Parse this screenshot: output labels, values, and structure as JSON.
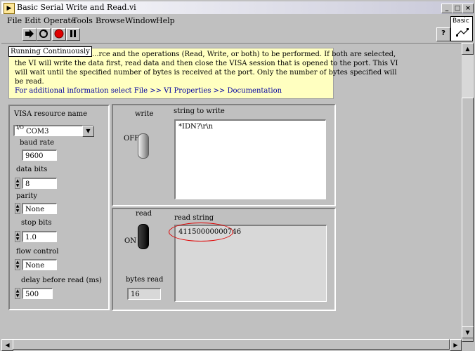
{
  "window": {
    "title": "Basic Serial Write and Read.vi",
    "controls": {
      "minimize": "_",
      "maximize": "□",
      "close": "×"
    }
  },
  "menu": [
    "File",
    "Edit",
    "Operate",
    "Tools",
    "Browse",
    "Window",
    "Help"
  ],
  "toolbar": {
    "buttons": [
      "run-arrow-icon",
      "run-continuously-icon",
      "abort-icon",
      "pause-icon"
    ],
    "help": "?",
    "palette_label": "Basic"
  },
  "status_tip": "Running Continuously",
  "description": {
    "line1": "...rce and the operations (Read, Write, or both) to be performed.  If both are selected,",
    "line2": "the VI will write the data first, read data and then close the VISA session that is opened to the port.  This VI",
    "line3": "will wait until the specified number of bytes is received at the port. Only the number of bytes specified will",
    "line4": "be read.",
    "link": "For additional information select File >> VI Properties >> Documentation"
  },
  "settings": {
    "visa_label": "VISA resource name",
    "visa_prefix": "I/O",
    "visa_value": "COM3",
    "baud_label": "baud rate",
    "baud_value": "9600",
    "databits_label": "data bits",
    "databits_value": "8",
    "parity_label": "parity",
    "parity_value": "None",
    "stopbits_label": "stop bits",
    "stopbits_value": "1.0",
    "flow_label": "flow control",
    "flow_value": "None",
    "delay_label": "delay before read (ms)",
    "delay_value": "500"
  },
  "write_section": {
    "switch_label": "write",
    "switch_state": "OFF",
    "string_label": "string to write",
    "string_value": "*IDN?\\r\\n"
  },
  "read_section": {
    "switch_label": "read",
    "switch_state": "ON",
    "string_label": "read string",
    "string_value": "41150000000746",
    "bytes_label": "bytes read",
    "bytes_value": "16"
  }
}
